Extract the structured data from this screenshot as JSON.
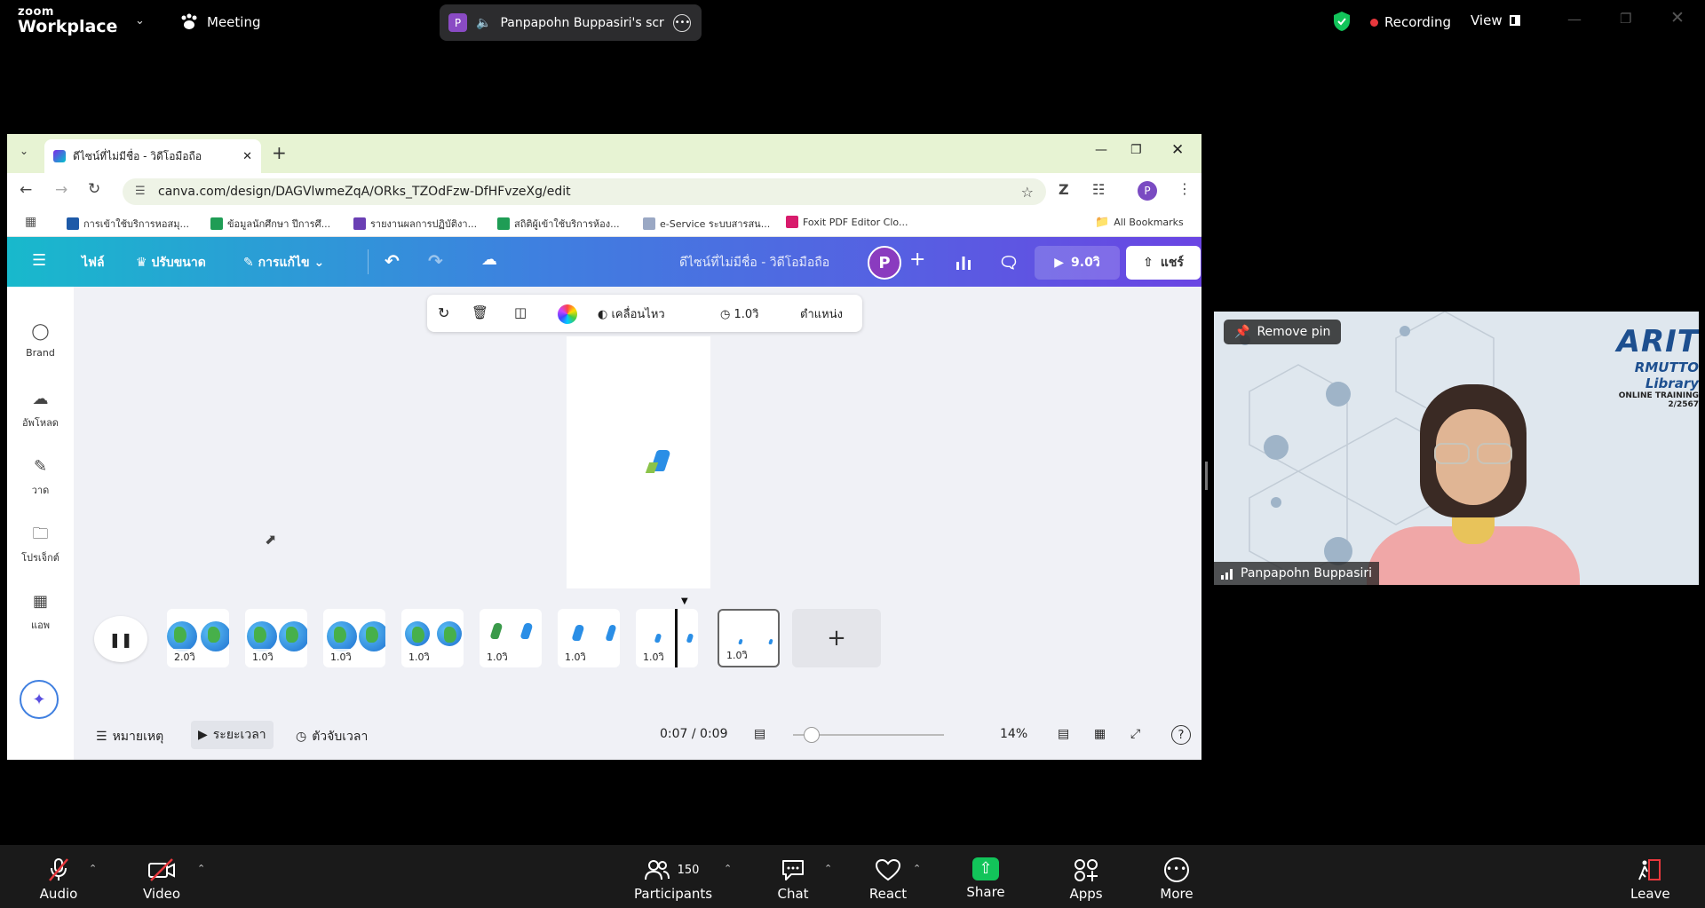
{
  "zoom": {
    "brand_line1": "zoom",
    "brand_line2": "Workplace",
    "meeting_label": "Meeting",
    "share_badge_initial": "P",
    "share_label": "Panpapohn Buppasiri's scree",
    "recording_label": "Recording",
    "view_label": "View",
    "pin_label": "Remove pin",
    "participant_name": "Panpapohn Buppasiri",
    "participants_count": "150",
    "toolbar": {
      "audio": "Audio",
      "video": "Video",
      "participants": "Participants",
      "chat": "Chat",
      "react": "React",
      "share": "Share",
      "apps": "Apps",
      "more": "More",
      "leave": "Leave"
    }
  },
  "browser": {
    "tab_title": "ดีไซน์ที่ไม่มีชื่อ - วิดีโอมือถือ",
    "url": "canva.com/design/DAGVlwmeZqA/ORks_TZOdFzw-DfHFvzeXg/edit",
    "profile_initial": "P",
    "bookmarks": [
      "การเข้าใช้บริการหอสมุ...",
      "ข้อมูลนักศึกษา ปีการศึ...",
      "รายงานผลการปฏิบัติงา...",
      "สถิติผู้เข้าใช้บริการห้อง...",
      "e-Service ระบบสารสน...",
      "Foxit PDF Editor Clo..."
    ],
    "all_bookmarks": "All Bookmarks"
  },
  "canva": {
    "menu": {
      "file": "ไฟล์",
      "resize": "ปรับขนาด",
      "edit": "การแก้ไข"
    },
    "design_title": "ดีไซน์ที่ไม่มีชื่อ - วิดีโอมือถือ",
    "avatar_initial": "P",
    "play_duration": "9.0วิ",
    "share_button": "แชร์",
    "rail": {
      "brand": "Brand",
      "uploads": "อัพโหลด",
      "draw": "วาด",
      "projects": "โปรเจ็กต์",
      "apps": "แอพ"
    },
    "element_toolbar": {
      "animate": "เคลื่อนไหว",
      "duration": "1.0วิ",
      "position": "ตำแหน่ง"
    },
    "timeline_frames": [
      {
        "duration": "2.0วิ"
      },
      {
        "duration": "1.0วิ"
      },
      {
        "duration": "1.0วิ"
      },
      {
        "duration": "1.0วิ"
      },
      {
        "duration": "1.0วิ"
      },
      {
        "duration": "1.0วิ"
      },
      {
        "duration": "1.0วิ"
      },
      {
        "duration": "1.0วิ"
      }
    ],
    "bottom": {
      "notes": "หมายเหตุ",
      "timeline": "ระยะเวลา",
      "timer": "ตัวจับเวลา",
      "time": "0:07 / 0:09",
      "zoom_level": "14%"
    }
  },
  "video_overlay": {
    "logo_text": "ARIT",
    "library": "RMUTTO Library",
    "training": "ONLINE TRAINING 2/2567"
  },
  "colors": {
    "canva_gradient_start": "#18b9cc",
    "canva_gradient_end": "#6a45e3",
    "recording_dot": "#e8383d",
    "share_green": "#12c45a"
  }
}
